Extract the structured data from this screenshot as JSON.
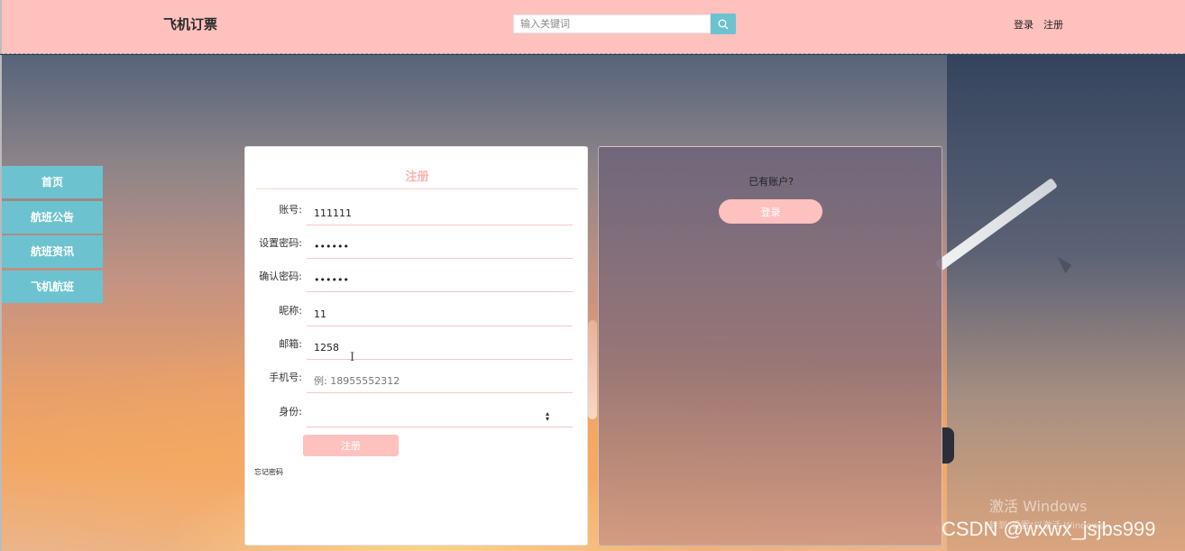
{
  "header": {
    "brand": "飞机订票",
    "search": {
      "placeholder": "输入关键词",
      "value": ""
    },
    "icon": "search-icon",
    "nav": {
      "login": "登录",
      "register": "注册"
    },
    "bg_color": "#fec1be",
    "accent_color": "#6cc3cf"
  },
  "sidebar": {
    "items": [
      {
        "label": "首页"
      },
      {
        "label": "航班公告"
      },
      {
        "label": "航班资讯"
      },
      {
        "label": "飞机航班"
      }
    ]
  },
  "register_form": {
    "title": "注册",
    "fields": [
      {
        "label": "账号:",
        "value": "111111",
        "placeholder": ""
      },
      {
        "label": "设置密码:",
        "value": "••••••",
        "placeholder": ""
      },
      {
        "label": "确认密码:",
        "value": "••••••",
        "placeholder": ""
      },
      {
        "label": "昵称:",
        "value": "11",
        "placeholder": ""
      },
      {
        "label": "邮箱:",
        "value": "1258",
        "placeholder": ""
      },
      {
        "label": "手机号:",
        "value": "",
        "placeholder": "例: 18955552312"
      }
    ],
    "role": {
      "label": "身份:",
      "selected": ""
    },
    "submit_label": "注册",
    "forgot_label": "忘记密码"
  },
  "login_panel": {
    "prompt": "已有账户?",
    "button_label": "登录"
  },
  "overlays": {
    "windows_title": "激活 Windows",
    "windows_sub": "转到\"设置\"以激活 Windows。",
    "watermark": "CSDN @wxwx_jsjbs999"
  }
}
